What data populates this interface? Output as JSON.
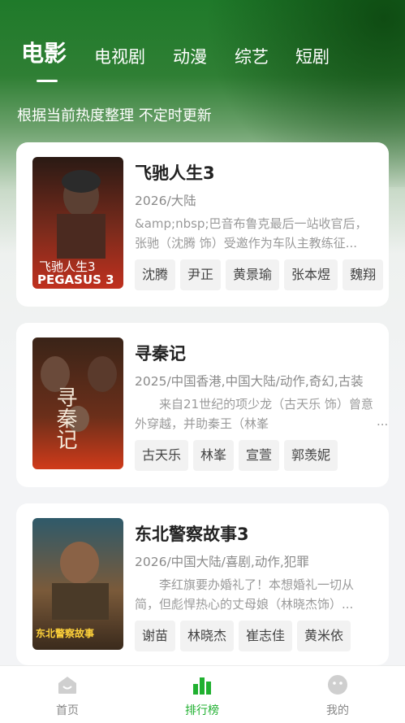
{
  "tabs": [
    {
      "label": "电影",
      "active": true
    },
    {
      "label": "电视剧"
    },
    {
      "label": "动漫"
    },
    {
      "label": "综艺"
    },
    {
      "label": "短剧"
    }
  ],
  "subtitle": "根据当前热度整理 不定时更新",
  "movies": [
    {
      "title": "飞驰人生3",
      "meta": "2026/大陆",
      "desc": "&amp;nbsp;巴音布鲁克最后一站收官后，张驰（沈腾 饰）受邀作为车队主教练征...",
      "tags": [
        "沈腾",
        "尹正",
        "黄景瑜",
        "张本煜",
        "魏翔"
      ],
      "poster_text": "飞驰人生3",
      "poster_sub": "PEGASUS 3"
    },
    {
      "title": "寻秦记",
      "meta": "2025/中国香港,中国大陆/动作,奇幻,古装",
      "desc": "来自21世纪的项少龙（古天乐 饰）曾意外穿越，并助秦王（林峯",
      "desc_more": "...",
      "tags": [
        "古天乐",
        "林峯",
        "宣萱",
        "郭羡妮"
      ],
      "poster_text": "寻秦记"
    },
    {
      "title": "东北警察故事3",
      "meta": "2026/中国大陆/喜剧,动作,犯罪",
      "desc": "李红旗要办婚礼了！本想婚礼一切从简，但彪悍热心的丈母娘（林晓杰饰）...",
      "tags": [
        "谢苗",
        "林晓杰",
        "崔志佳",
        "黄米依"
      ],
      "poster_text": "东北警察故事"
    }
  ],
  "nav": [
    {
      "label": "首页",
      "icon": "home-icon"
    },
    {
      "label": "排行榜",
      "icon": "ranking-icon",
      "active": true
    },
    {
      "label": "我的",
      "icon": "profile-icon"
    }
  ],
  "colors": {
    "accent": "#20b030",
    "header_green": "#1f7a2a"
  }
}
